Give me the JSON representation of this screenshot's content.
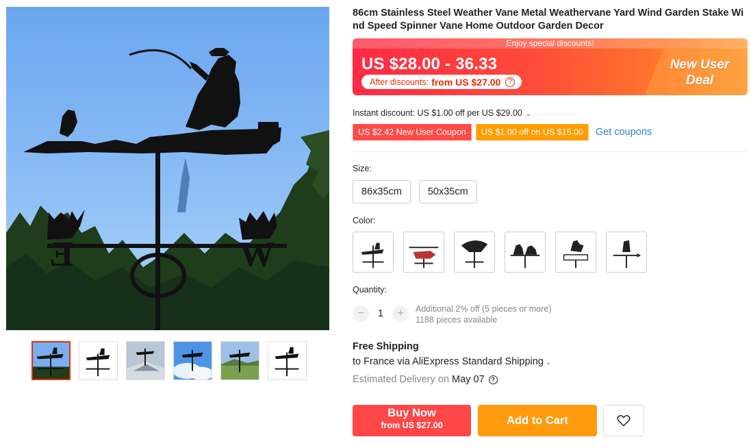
{
  "product": {
    "title": "86cm Stainless Steel Weather Vane Metal Weathervane Yard Wind Garden Stake Wind Speed Spinner Vane Home Outdoor Garden Decor"
  },
  "price_banner": {
    "enjoy_text": "Enjoy special discounts!",
    "price_range": "US $28.00 - 36.33",
    "after_label": "After discounts:",
    "after_value": "from US $27.00",
    "deal_line1": "New User",
    "deal_line2": "Deal"
  },
  "instant_discount": "Instant discount: US $1.00 off per US $29.00",
  "coupons": {
    "items": [
      "US $2.42 New User Coupon",
      "US $1.00 off on US $15.00"
    ],
    "get_label": "Get coupons"
  },
  "size": {
    "label": "Size:",
    "options": [
      "86x35cm",
      "50x35cm"
    ]
  },
  "color": {
    "label": "Color:",
    "options": [
      "fisherman",
      "helicopter",
      "eagle",
      "dog-and-cat",
      "rooster-chicken-crossing",
      "bigfoot"
    ]
  },
  "quantity": {
    "label": "Quantity:",
    "value": "1",
    "minus": "−",
    "plus": "+",
    "note_line1": "Additional 2% off (5 pieces or more)",
    "note_line2": "1188 pieces available"
  },
  "shipping": {
    "title": "Free Shipping",
    "to": "to France via AliExpress Standard Shipping",
    "estimated_label": "Estimated Delivery on",
    "date": "May 07",
    "help": "?"
  },
  "actions": {
    "buy_now": "Buy Now",
    "buy_now_sub": "from US $27.00",
    "add_to_cart": "Add to Cart"
  },
  "gallery": {
    "main_letters": [
      "E",
      "W"
    ],
    "thumbnail_count": 6,
    "active_thumbnail": 1
  },
  "colors_accent": {
    "red": "#ff4747",
    "orange": "#ff9a0d",
    "link": "#2a83c4"
  }
}
